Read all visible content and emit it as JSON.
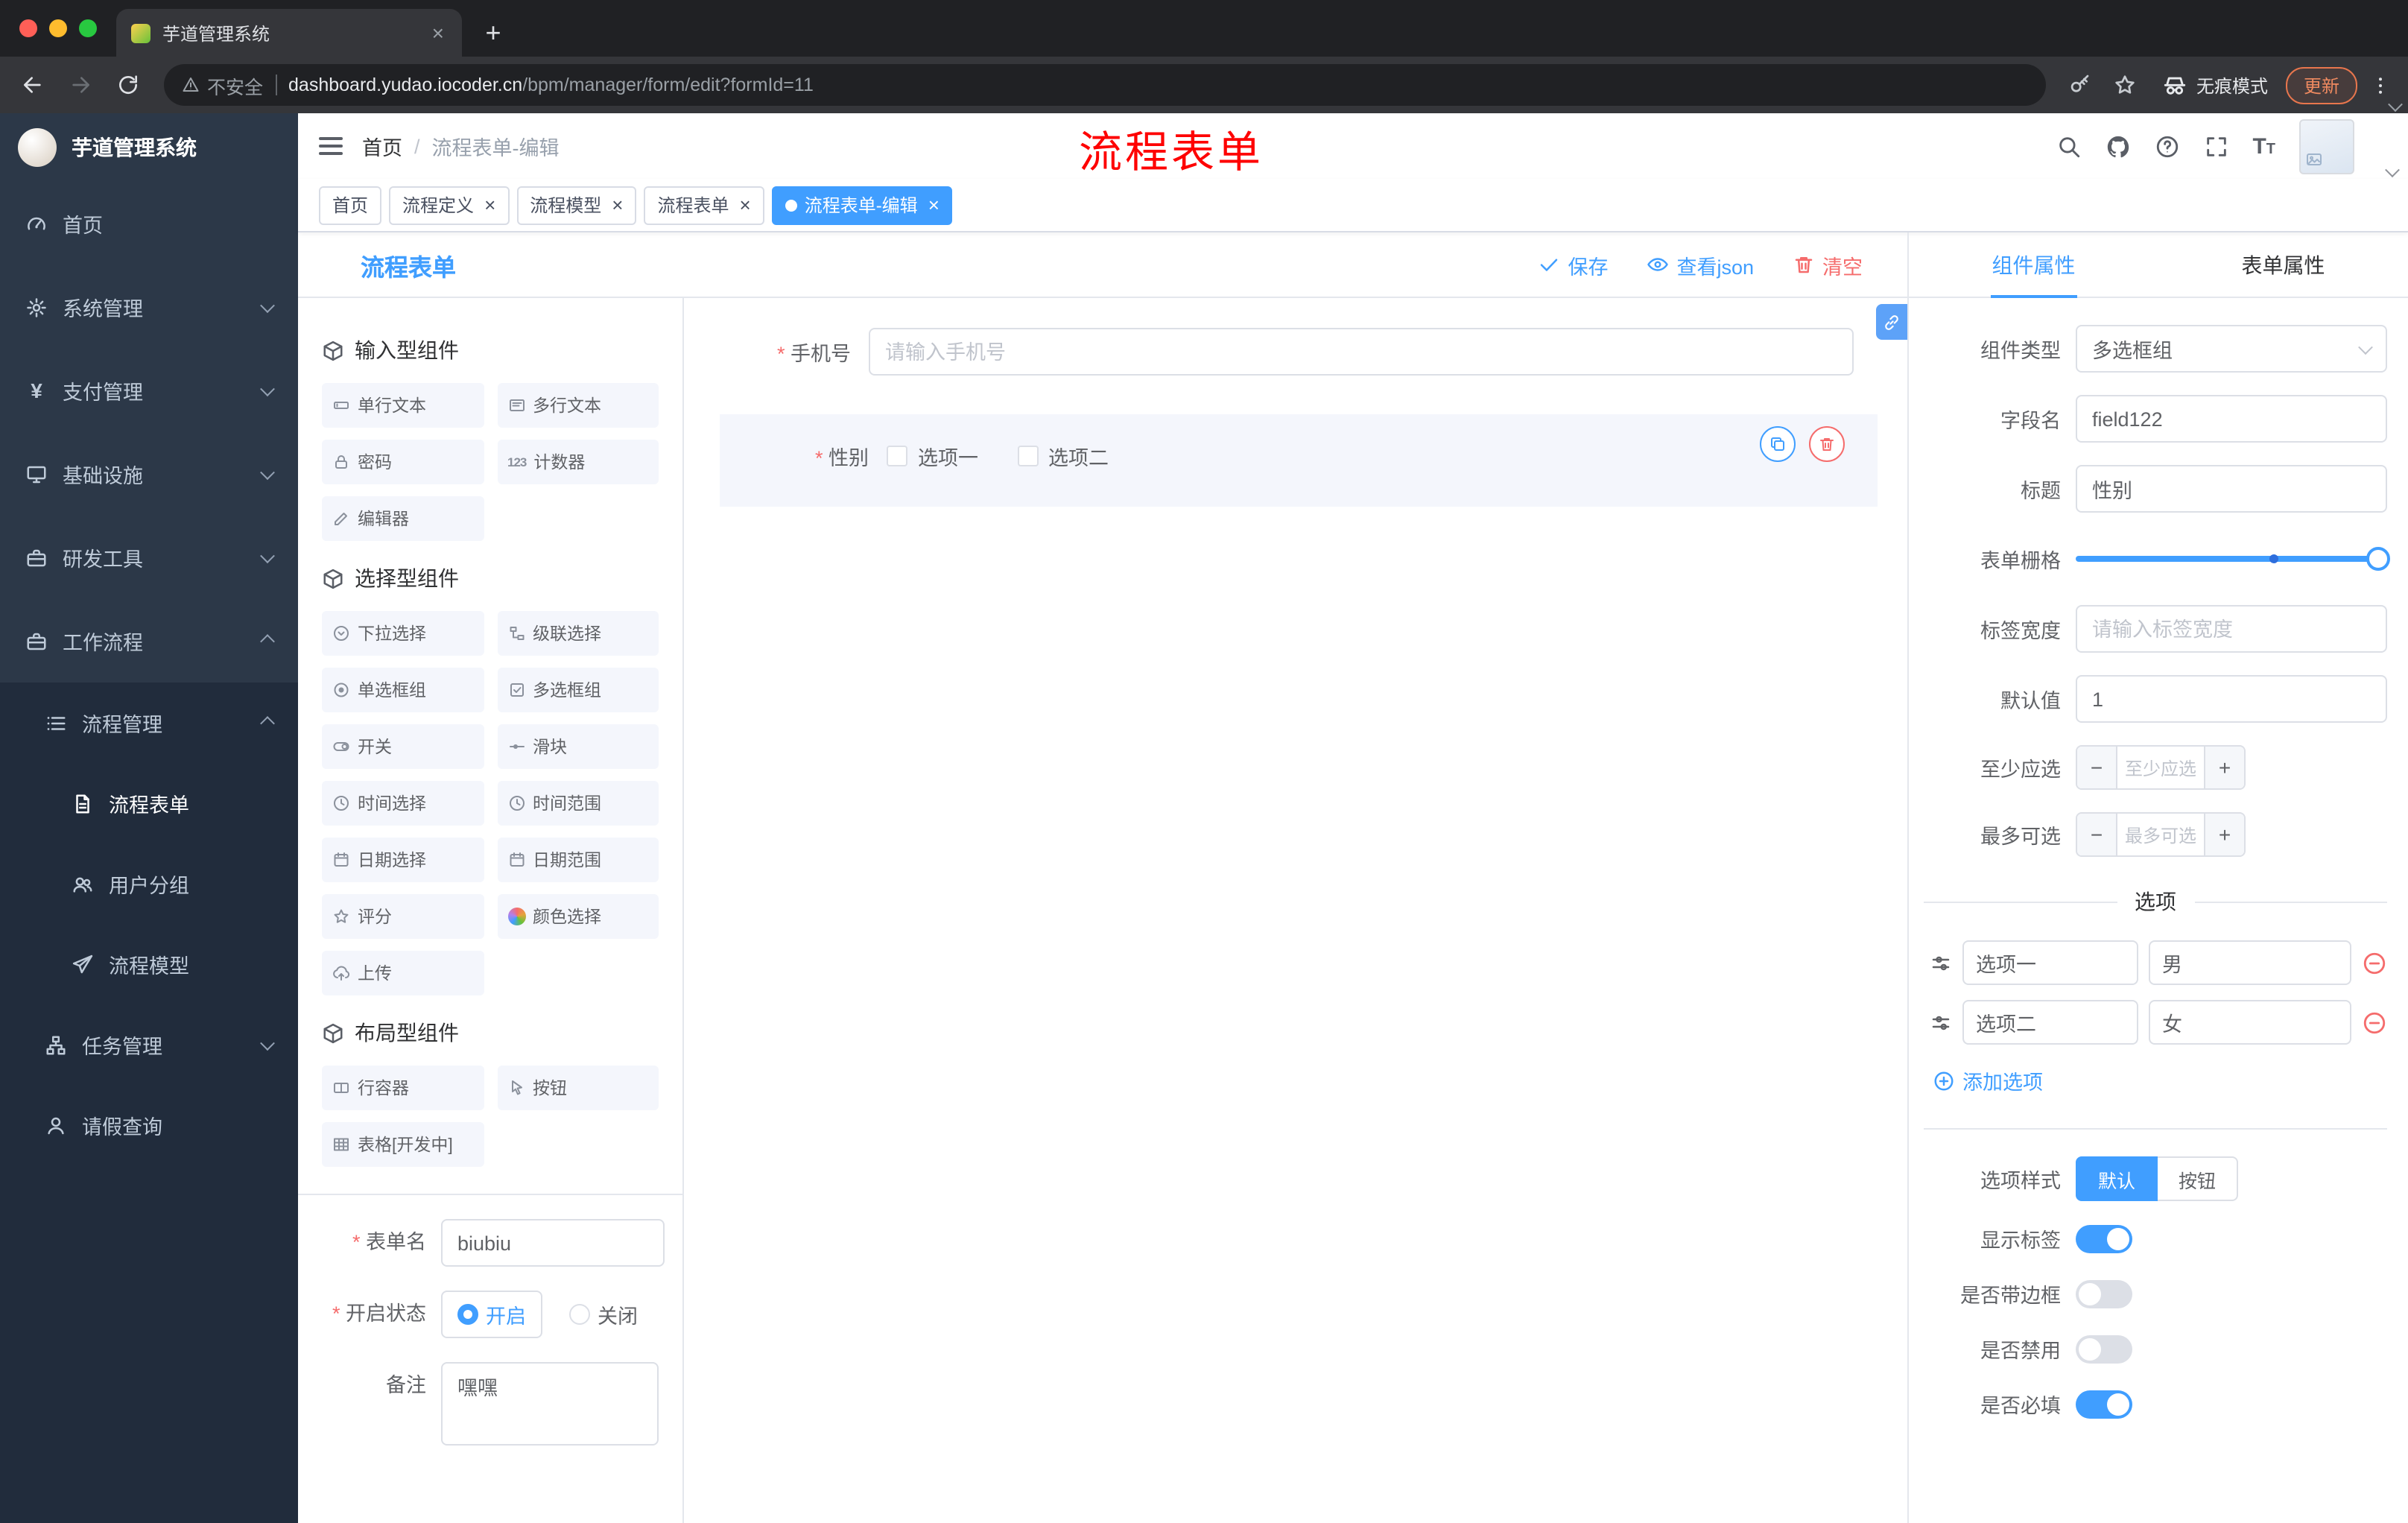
{
  "colors": {
    "accent": "#409eff",
    "danger": "#f56c6c",
    "update_button": "#ef8a60",
    "sidebar_bg": "#2c3848"
  },
  "browser": {
    "tab": {
      "title": "芋道管理系统"
    },
    "address": {
      "security": "不安全",
      "host": "dashboard.yudao.iocoder.cn",
      "path": "/bpm/manager/form/edit?formId=11"
    },
    "incognito_label": "无痕模式",
    "update_label": "更新"
  },
  "sidebar": {
    "title": "芋道管理系统",
    "items": [
      {
        "label": "首页",
        "icon": "dashboard-icon"
      },
      {
        "label": "系统管理",
        "icon": "gear-icon",
        "state": "collapsed"
      },
      {
        "label": "支付管理",
        "icon": "yen-icon",
        "state": "collapsed"
      },
      {
        "label": "基础设施",
        "icon": "monitor-icon",
        "state": "collapsed"
      },
      {
        "label": "研发工具",
        "icon": "briefcase-icon",
        "state": "collapsed"
      },
      {
        "label": "工作流程",
        "icon": "toolbox-icon",
        "state": "expanded"
      },
      {
        "label": "流程管理",
        "icon": "list-icon",
        "state": "expanded"
      },
      {
        "label": "流程表单",
        "icon": "document-icon",
        "active": true
      },
      {
        "label": "用户分组",
        "icon": "users-icon"
      },
      {
        "label": "流程模型",
        "icon": "send-icon"
      },
      {
        "label": "任务管理",
        "icon": "tree-icon",
        "state": "collapsed"
      },
      {
        "label": "请假查询",
        "icon": "person-icon"
      }
    ]
  },
  "header": {
    "breadcrumb": [
      "首页",
      "流程表单-编辑"
    ],
    "annotation": "流程表单",
    "icons": [
      "search-icon",
      "github-icon",
      "help-icon",
      "fullscreen-icon",
      "font-size-icon",
      "avatar"
    ]
  },
  "tags": [
    {
      "label": "首页",
      "closable": false,
      "active": false
    },
    {
      "label": "流程定义",
      "closable": true,
      "active": false
    },
    {
      "label": "流程模型",
      "closable": true,
      "active": false
    },
    {
      "label": "流程表单",
      "closable": true,
      "active": false
    },
    {
      "label": "流程表单-编辑",
      "closable": true,
      "active": true
    }
  ],
  "editor": {
    "title": "流程表单",
    "actions": {
      "save": "保存",
      "view_json": "查看json",
      "clear": "清空"
    },
    "palette": {
      "groups": [
        {
          "title": "输入型组件",
          "items": [
            {
              "label": "单行文本",
              "icon": "input-icon"
            },
            {
              "label": "多行文本",
              "icon": "textarea-icon"
            },
            {
              "label": "密码",
              "icon": "lock-icon"
            },
            {
              "label": "计数器",
              "icon": "counter-icon"
            },
            {
              "label": "编辑器",
              "icon": "editor-icon"
            }
          ]
        },
        {
          "title": "选择型组件",
          "items": [
            {
              "label": "下拉选择",
              "icon": "select-icon"
            },
            {
              "label": "级联选择",
              "icon": "cascader-icon"
            },
            {
              "label": "单选框组",
              "icon": "radio-icon"
            },
            {
              "label": "多选框组",
              "icon": "checkbox-icon"
            },
            {
              "label": "开关",
              "icon": "switch-icon"
            },
            {
              "label": "滑块",
              "icon": "slider-icon"
            },
            {
              "label": "时间选择",
              "icon": "time-icon"
            },
            {
              "label": "时间范围",
              "icon": "time-range-icon"
            },
            {
              "label": "日期选择",
              "icon": "date-icon"
            },
            {
              "label": "日期范围",
              "icon": "date-range-icon"
            },
            {
              "label": "评分",
              "icon": "rate-icon"
            },
            {
              "label": "颜色选择",
              "icon": "color-icon"
            },
            {
              "label": "上传",
              "icon": "upload-icon"
            }
          ]
        },
        {
          "title": "布局型组件",
          "items": [
            {
              "label": "行容器",
              "icon": "row-icon"
            },
            {
              "label": "按钮",
              "icon": "button-icon"
            },
            {
              "label": "表格[开发中]",
              "icon": "table-icon"
            }
          ]
        }
      ]
    },
    "form_meta": {
      "name_label": "表单名",
      "name_value": "biubiu",
      "status_label": "开启状态",
      "status_on": "开启",
      "status_off": "关闭",
      "status_selected": "开启",
      "remark_label": "备注",
      "remark_value": "嘿嘿"
    },
    "canvas": {
      "phone": {
        "label": "手机号",
        "placeholder": "请输入手机号",
        "required": true
      },
      "gender": {
        "label": "性别",
        "required": true,
        "options": [
          {
            "label": "选项一"
          },
          {
            "label": "选项二"
          }
        ],
        "selected": true
      }
    }
  },
  "props": {
    "tabs": [
      {
        "label": "组件属性"
      },
      {
        "label": "表单属性"
      }
    ],
    "active_tab": "组件属性",
    "component_type": {
      "label": "组件类型",
      "value": "多选框组"
    },
    "field_name": {
      "label": "字段名",
      "value": "field122"
    },
    "title": {
      "label": "标题",
      "value": "性别"
    },
    "grid": {
      "label": "表单栅格",
      "value_percent": 100
    },
    "label_width": {
      "label": "标签宽度",
      "placeholder": "请输入标签宽度"
    },
    "default_value": {
      "label": "默认值",
      "value": "1"
    },
    "min_select": {
      "label": "至少应选",
      "placeholder": "至少应选"
    },
    "max_select": {
      "label": "最多可选",
      "placeholder": "最多可选"
    },
    "options": {
      "title": "选项",
      "items": [
        {
          "label": "选项一",
          "value": "男"
        },
        {
          "label": "选项二",
          "value": "女"
        }
      ],
      "add_label": "添加选项"
    },
    "option_style": {
      "label": "选项样式",
      "choices": [
        {
          "label": "默认"
        },
        {
          "label": "按钮"
        }
      ],
      "selected": "默认"
    },
    "toggles": [
      {
        "label": "显示标签",
        "on": true
      },
      {
        "label": "是否带边框",
        "on": false
      },
      {
        "label": "是否禁用",
        "on": false
      },
      {
        "label": "是否必填",
        "on": true
      }
    ]
  }
}
